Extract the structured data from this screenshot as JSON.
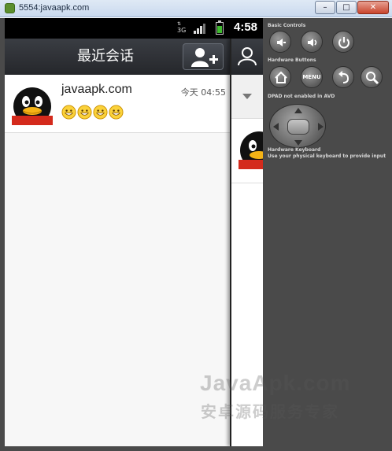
{
  "window": {
    "title": "5554:javaapk.com",
    "minimize": "–",
    "maximize": "□",
    "close": "✕"
  },
  "status_bar": {
    "network": "3G",
    "time": "4:58"
  },
  "header": {
    "title": "最近会话"
  },
  "conversations": [
    {
      "name": "javaapk.com",
      "time": "今天 04:55",
      "emoji_count": 4
    }
  ],
  "controls": {
    "basic_controls_label": "Basic Controls",
    "hardware_buttons_label": "Hardware Buttons",
    "menu_label": "MENU",
    "dpad_label": "DPAD not enabled in AVD",
    "keyboard_label": "Hardware Keyboard",
    "keyboard_note": "Use your physical keyboard to provide input"
  },
  "watermark": {
    "line1": "JavaApk.com",
    "line2": "安卓源码服务专家"
  },
  "colors": {
    "header_bg": "#2c2f34",
    "battery": "#3fba2f",
    "emulator_bg": "#4a4a4a"
  }
}
